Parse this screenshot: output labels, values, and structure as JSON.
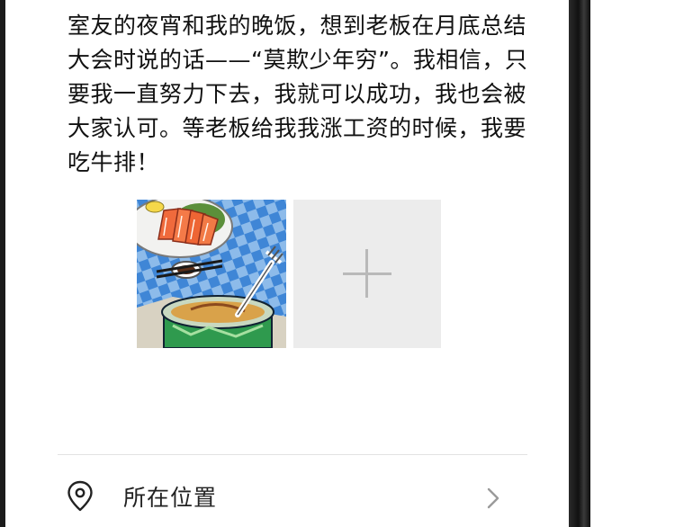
{
  "post": {
    "text": "室友的夜宵和我的晚饭，想到老板在月底总结大会时说的话——“莫欺少年穷”。我相信，只要我一直努力下去，我就可以成功，我也会被大家认可。等老板给我我涨工资的时候，我要吃牛排！"
  },
  "photos": [
    {
      "icon": "food-photo-icon"
    }
  ],
  "add_photo": {
    "icon": "plus-icon"
  },
  "location": {
    "label": "所在位置",
    "icon": "location-pin-icon",
    "chevron_icon": "chevron-right-icon"
  },
  "colors": {
    "text": "#111111",
    "add_tile_bg": "#ececec",
    "plus": "#b9b9b9",
    "divider": "#e3e3e3",
    "bezel": "#1b1b1b"
  }
}
